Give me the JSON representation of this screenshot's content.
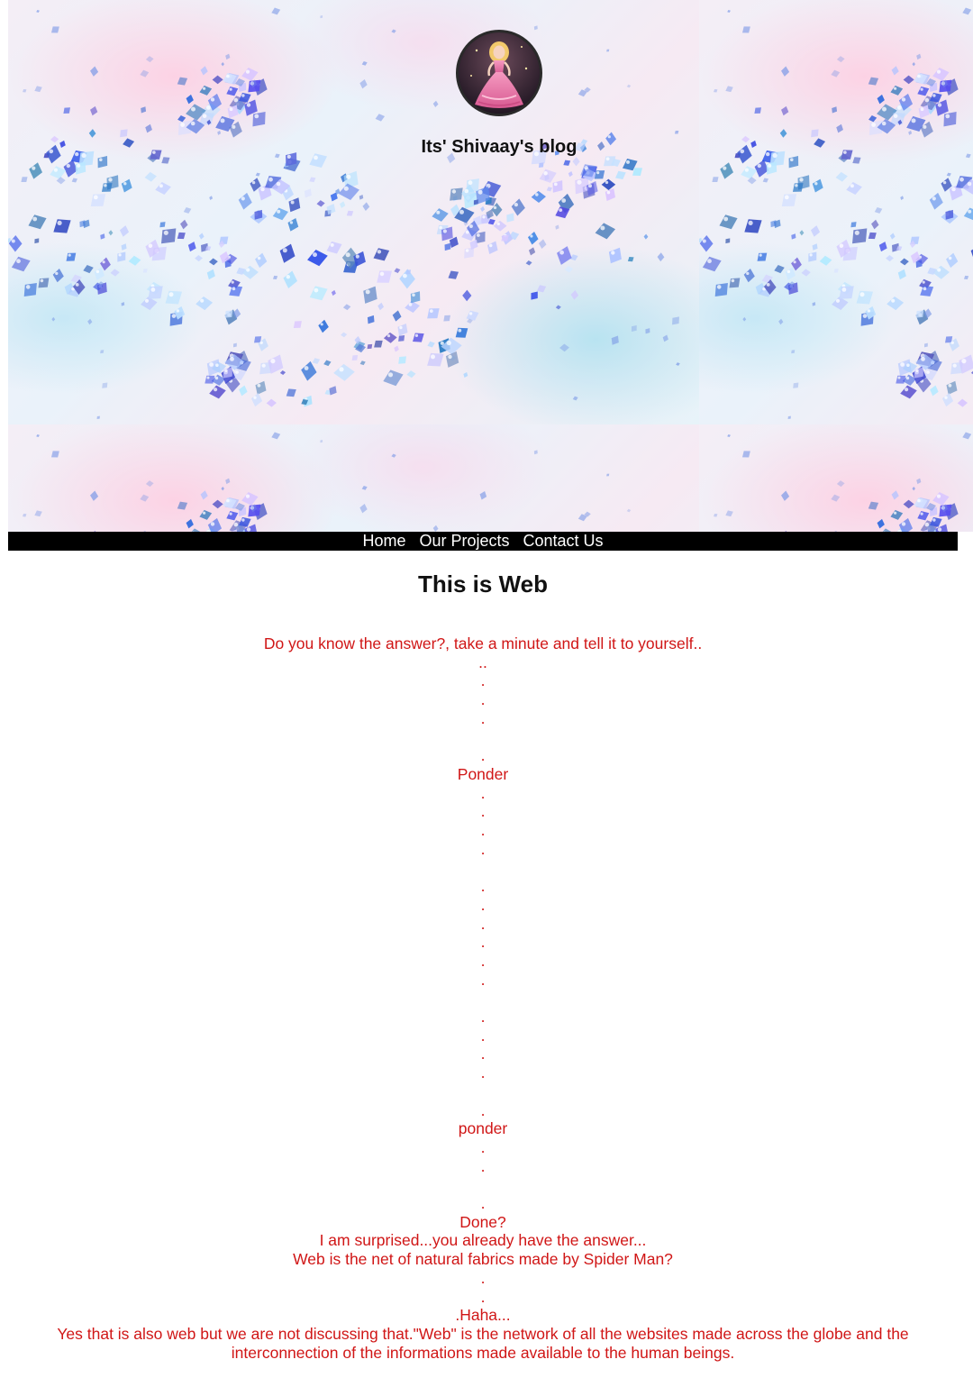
{
  "header": {
    "blog_title": "Its' Shivaay's blog",
    "avatar_icon": "profile-picture-avatar"
  },
  "nav": {
    "items": [
      {
        "label": "Home"
      },
      {
        "label": "Our Projects"
      },
      {
        "label": "Contact Us"
      }
    ]
  },
  "post": {
    "title": "This is Web",
    "lines": [
      "Do you know the answer?, take a minute and tell it to yourself..",
      "..",
      ".",
      ".",
      ".",
      "",
      ".",
      "Ponder",
      ".",
      ".",
      ".",
      ".",
      "",
      ".",
      ".",
      ".",
      ".",
      ".",
      ".",
      "",
      ".",
      ".",
      ".",
      ".",
      "",
      ".",
      "ponder",
      ".",
      ".",
      "",
      ".",
      "Done?",
      "I am surprised...you already have the answer...",
      "Web is the net of natural fabrics made by Spider Man?",
      ".",
      ".",
      ".Haha...",
      "Yes that is also web but we are not discussing that.\"Web\" is the network of all the websites made across the globe and the interconnection of the informations made available to the human beings."
    ]
  },
  "colors": {
    "nav_background": "#000000",
    "nav_text": "#ffffff",
    "body_text": "#d01616",
    "title_text": "#111111"
  }
}
